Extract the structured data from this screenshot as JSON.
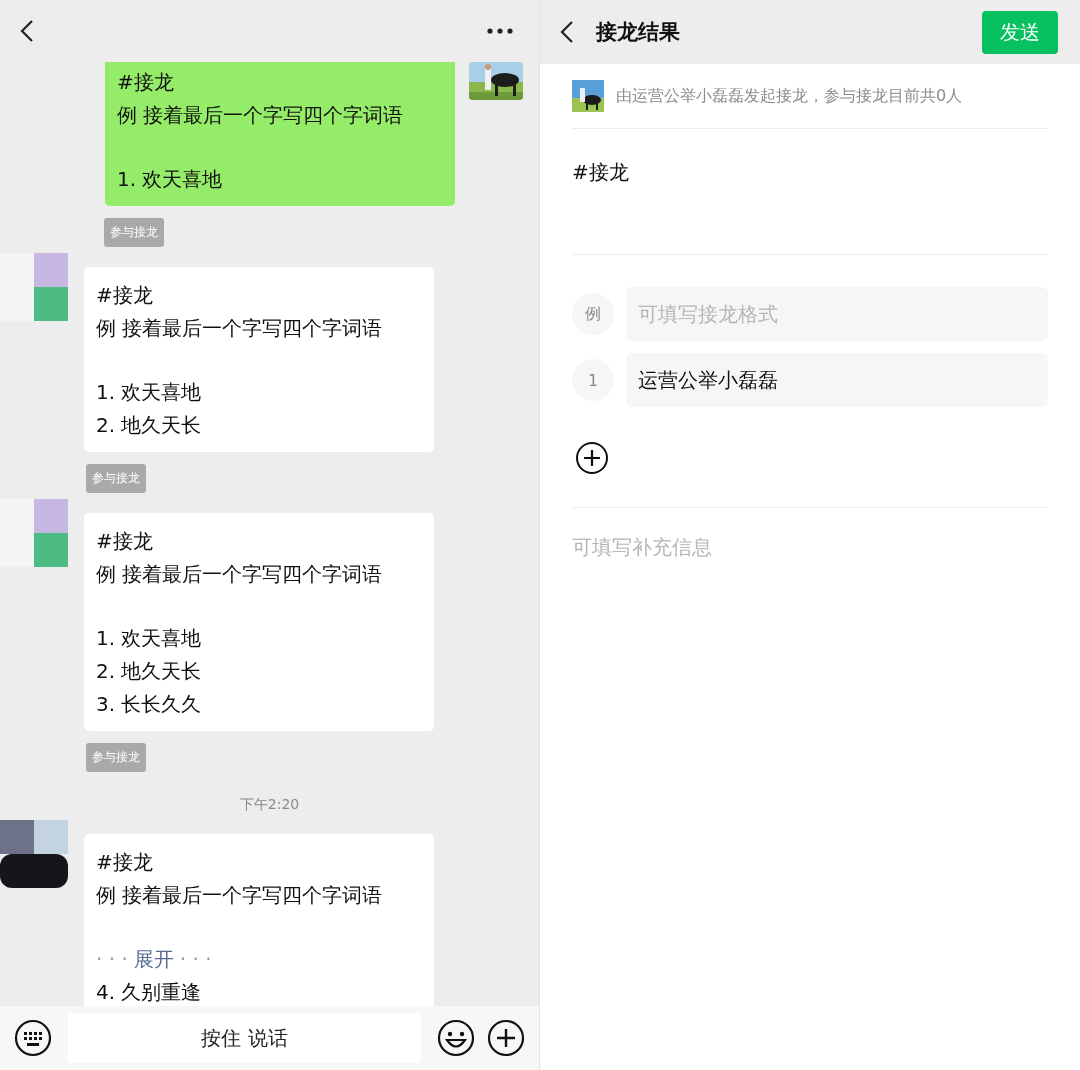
{
  "chat": {
    "items": [
      {
        "kind": "outgoing",
        "title": "#接龙",
        "prompt": "例 接着最后一个字写四个字词语",
        "entries": [
          "1. 欢天喜地"
        ]
      },
      {
        "kind": "tag",
        "text": "参与接龙"
      },
      {
        "kind": "incoming",
        "title": "#接龙",
        "prompt": "例 接着最后一个字写四个字词语",
        "entries": [
          "1. 欢天喜地",
          "2. 地久天长"
        ]
      },
      {
        "kind": "tag",
        "text": "参与接龙"
      },
      {
        "kind": "incoming",
        "title": "#接龙",
        "prompt": "例 接着最后一个字写四个字词语",
        "entries": [
          "1. 欢天喜地",
          "2. 地久天长",
          "3. 长长久久"
        ]
      },
      {
        "kind": "tag",
        "text": "参与接龙"
      },
      {
        "kind": "time",
        "text": "下午2:20"
      },
      {
        "kind": "incoming",
        "title": "#接龙",
        "prompt": "例 接着最后一个字写四个字词语",
        "expand": {
          "lead": "· · ·",
          "label": "展开",
          "trail": "· · ·"
        },
        "entries": [
          "4. 久别重逢"
        ]
      }
    ]
  },
  "input_bar": {
    "voice_button": "按住 说话"
  },
  "result": {
    "title": "接龙结果",
    "send_button": "发送",
    "initiator": "由运营公举小磊磊发起接龙，参与接龙目前共0人",
    "topic": "#接龙",
    "rows": [
      {
        "kind": "example",
        "badge": "例",
        "placeholder": "可填写接龙格式"
      },
      {
        "kind": "entry",
        "badge": "1",
        "value": "运营公举小磊磊"
      }
    ],
    "extra": {
      "placeholder": "可填写补充信息"
    }
  }
}
